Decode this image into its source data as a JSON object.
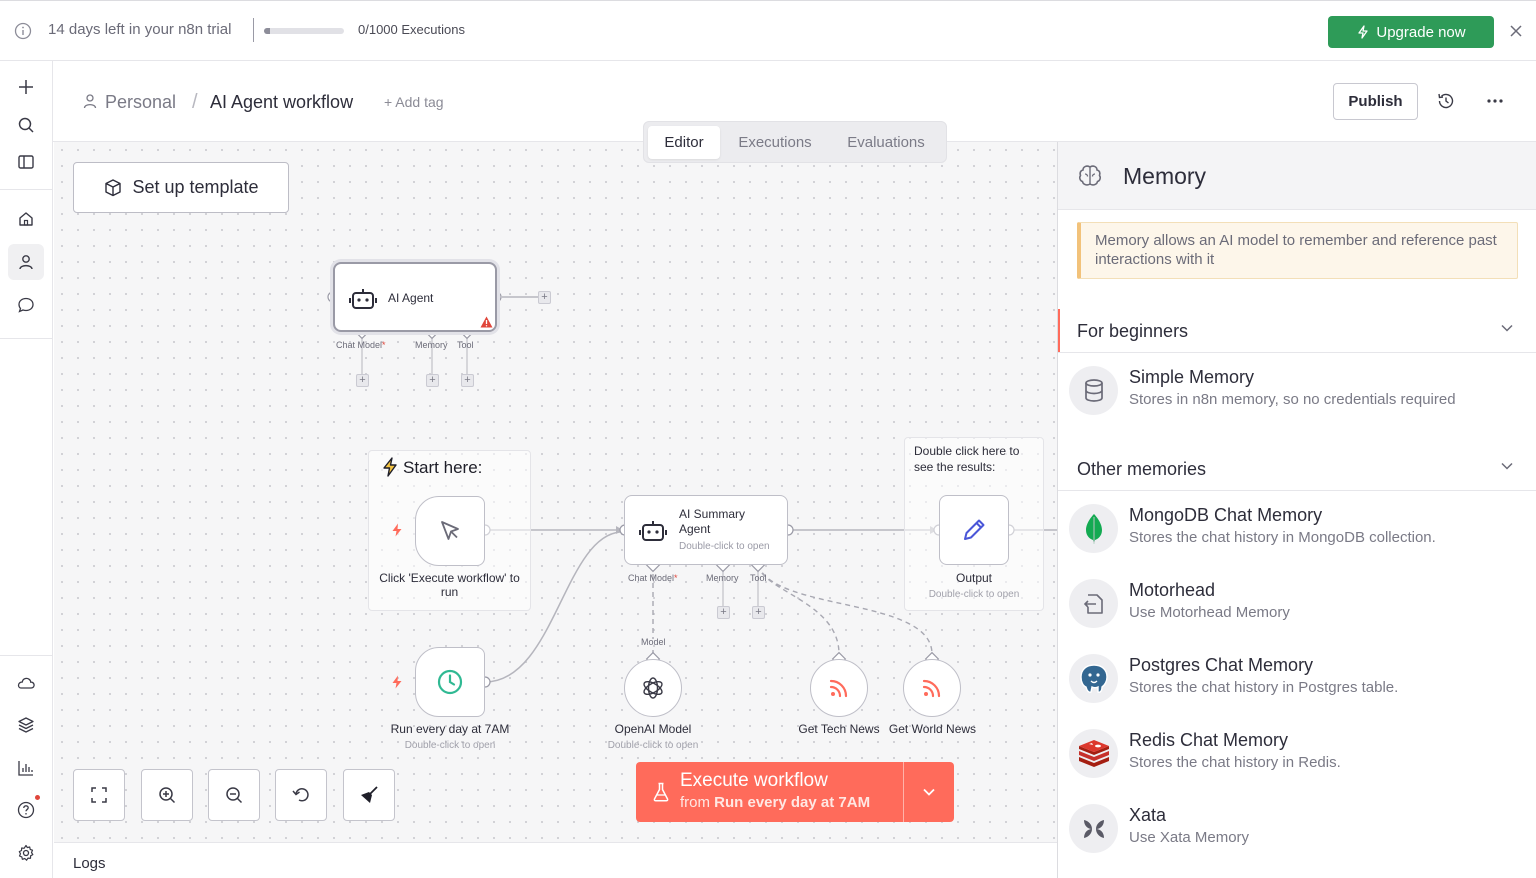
{
  "banner": {
    "trial_text": "14 days left in your n8n trial",
    "executions_text": "0/1000 Executions",
    "executions_used_fraction": 0.0,
    "upgrade_label": "Upgrade now",
    "upgrade_color": "#2e9b58"
  },
  "header": {
    "project": "Personal",
    "workflow_name": "AI Agent workflow",
    "add_tag": "+ Add tag",
    "publish_label": "Publish",
    "tabs": [
      {
        "label": "Editor",
        "active": true
      },
      {
        "label": "Executions",
        "active": false
      },
      {
        "label": "Evaluations",
        "active": false
      }
    ]
  },
  "canvas": {
    "setup_template_label": "Set up template",
    "agent_node": {
      "title": "AI Agent",
      "ports": [
        "Chat Model",
        "Memory",
        "Tool"
      ],
      "required_mark": "*"
    },
    "sticky_start": {
      "title": "Start here:"
    },
    "sticky_output": {
      "text": "Double click here to see the results:"
    },
    "manual_trigger": {
      "label": "Click 'Execute workflow' to run"
    },
    "summary_agent": {
      "title": "AI Summary Agent",
      "subtitle": "Double-click to open",
      "ports": [
        "Chat Model",
        "Memory",
        "Tool"
      ],
      "required_mark": "*"
    },
    "output_node": {
      "label": "Output",
      "subtitle": "Double-click to open"
    },
    "schedule_node": {
      "label": "Run every day at 7AM",
      "subtitle": "Double-click to open"
    },
    "openai_node": {
      "label": "OpenAI Model",
      "subtitle": "Double-click to open",
      "port_label": "Model"
    },
    "tech_news": {
      "label": "Get Tech News"
    },
    "world_news": {
      "label": "Get World News"
    },
    "execute": {
      "label": "Execute workflow",
      "from_prefix": "from",
      "from_node": "Run every day at 7AM",
      "color": "#ff6b5b"
    },
    "logs_label": "Logs",
    "accent_color": "#ff6b5b"
  },
  "panel": {
    "title": "Memory",
    "callout": "Memory allows an AI model to remember and reference past interactions with it",
    "sections": [
      {
        "label": "For beginners",
        "items": [
          {
            "name": "Simple Memory",
            "desc": "Stores in n8n memory, so no credentials required",
            "icon": "database-icon"
          }
        ]
      },
      {
        "label": "Other memories",
        "items": [
          {
            "name": "MongoDB Chat Memory",
            "desc": "Stores the chat history in MongoDB collection.",
            "icon": "mongodb-icon"
          },
          {
            "name": "Motorhead",
            "desc": "Use Motorhead Memory",
            "icon": "motorhead-icon"
          },
          {
            "name": "Postgres Chat Memory",
            "desc": "Stores the chat history in Postgres table.",
            "icon": "postgres-icon"
          },
          {
            "name": "Redis Chat Memory",
            "desc": "Stores the chat history in Redis.",
            "icon": "redis-icon"
          },
          {
            "name": "Xata",
            "desc": "Use Xata Memory",
            "icon": "xata-icon"
          }
        ]
      }
    ]
  }
}
